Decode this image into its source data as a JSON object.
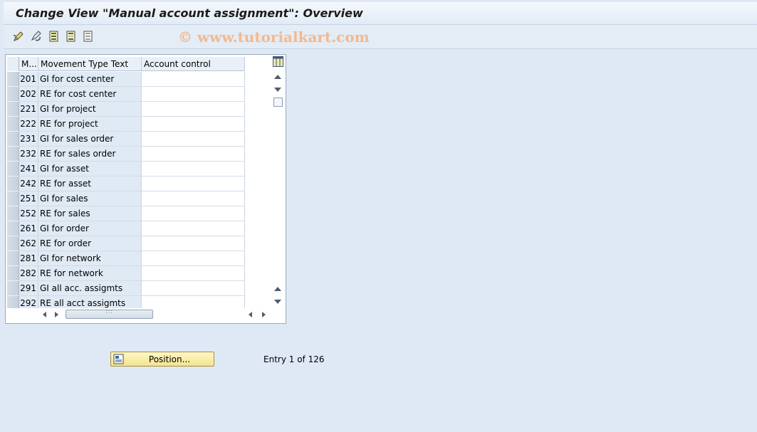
{
  "window": {
    "title": "Change View \"Manual account assignment\": Overview"
  },
  "toolbar": {
    "icons": [
      "display-change-icon",
      "undo-icon",
      "select-all-icon",
      "select-block-icon",
      "deselect-all-icon"
    ],
    "watermark": "© www.tutorialkart.com"
  },
  "table": {
    "columns": [
      "M...",
      "Movement Type Text",
      "Account control"
    ],
    "rows": [
      {
        "mvt": "201",
        "text": "GI for cost center",
        "account_control": ""
      },
      {
        "mvt": "202",
        "text": "RE for cost center",
        "account_control": ""
      },
      {
        "mvt": "221",
        "text": "GI for project",
        "account_control": ""
      },
      {
        "mvt": "222",
        "text": "RE for project",
        "account_control": ""
      },
      {
        "mvt": "231",
        "text": "GI for sales order",
        "account_control": ""
      },
      {
        "mvt": "232",
        "text": "RE for sales order",
        "account_control": ""
      },
      {
        "mvt": "241",
        "text": "GI for asset",
        "account_control": ""
      },
      {
        "mvt": "242",
        "text": "RE for asset",
        "account_control": ""
      },
      {
        "mvt": "251",
        "text": "GI for sales",
        "account_control": ""
      },
      {
        "mvt": "252",
        "text": "RE for sales",
        "account_control": ""
      },
      {
        "mvt": "261",
        "text": "GI for order",
        "account_control": ""
      },
      {
        "mvt": "262",
        "text": "RE for order",
        "account_control": ""
      },
      {
        "mvt": "281",
        "text": "GI for network",
        "account_control": ""
      },
      {
        "mvt": "282",
        "text": "RE for network",
        "account_control": ""
      },
      {
        "mvt": "291",
        "text": "GI all acc. assigmts",
        "account_control": ""
      },
      {
        "mvt": "292",
        "text": "RE all acct assigmts",
        "account_control": ""
      }
    ]
  },
  "footer": {
    "position_button": "Position...",
    "entry_text": "Entry 1 of 126"
  },
  "colors": {
    "background": "#dfe9f5",
    "key_column": "#dfeaf5",
    "button": "#f6e38d"
  }
}
